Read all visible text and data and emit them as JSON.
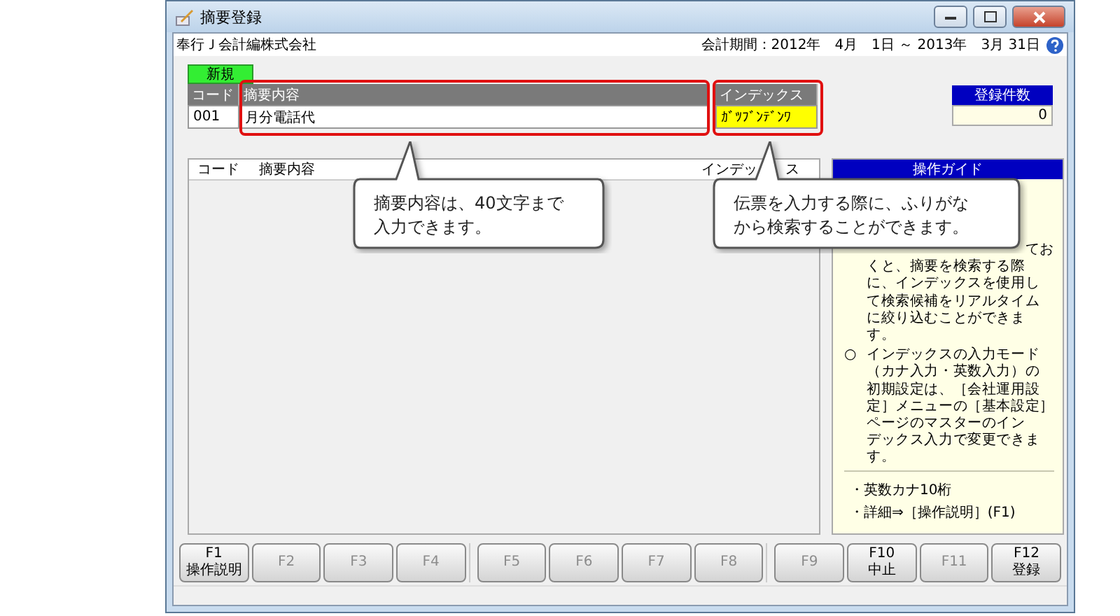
{
  "window": {
    "title": "摘要登録"
  },
  "company": {
    "name": "奉行Ｊ会計編株式会社",
    "period": "会計期間：2012年　4月　1日 ～ 2013年　3月 31日"
  },
  "mode_tab": "新規",
  "entry": {
    "columns": [
      "コード",
      "摘要内容",
      "インデックス"
    ],
    "code": "001",
    "summary": "月分電話代",
    "index": "ｶﾞﾂﾌﾞﾝﾃﾞﾝﾜ"
  },
  "count": {
    "label": "登録件数",
    "value": "0"
  },
  "list": {
    "columns": [
      "コード",
      "摘要内容",
      "インデッ",
      "ス"
    ]
  },
  "guide": {
    "title": "操作ガイド",
    "items": [
      {
        "lines": [
          "てお",
          "くと、摘要を検索する際",
          "に、インデックスを使用し",
          "て検索候補をリアルタイム",
          "に絞り込むことができま",
          "す。"
        ]
      },
      {
        "marker": "○",
        "lines": [
          "インデックスの入力モード",
          "（カナ入力・英数入力）の",
          "初期設定は、［会社運用設",
          "定］メニューの［基本設定］",
          "ページのマスターのイン",
          "デックス入力で変更できま",
          "す。"
        ]
      }
    ],
    "notes": [
      "・英数カナ10桁",
      "・詳細⇒［操作説明］(F1)"
    ]
  },
  "callouts": [
    {
      "lines": [
        "摘要内容は、40文字まで",
        "入力できます。"
      ]
    },
    {
      "lines": [
        "伝票を入力する際に、ふりがな",
        "から検索することができます。"
      ]
    }
  ],
  "function_keys": [
    {
      "key": "F1",
      "label": "操作説明",
      "disabled": false
    },
    {
      "key": "F2",
      "disabled": true
    },
    {
      "key": "F3",
      "disabled": true
    },
    {
      "key": "F4",
      "disabled": true
    },
    {
      "key": "F5",
      "disabled": true
    },
    {
      "key": "F6",
      "disabled": true
    },
    {
      "key": "F7",
      "disabled": true
    },
    {
      "key": "F8",
      "disabled": true
    },
    {
      "key": "F9",
      "disabled": true
    },
    {
      "key": "F10",
      "label": "中止",
      "disabled": false
    },
    {
      "key": "F11",
      "disabled": true
    },
    {
      "key": "F12",
      "label": "登録",
      "disabled": false
    }
  ]
}
